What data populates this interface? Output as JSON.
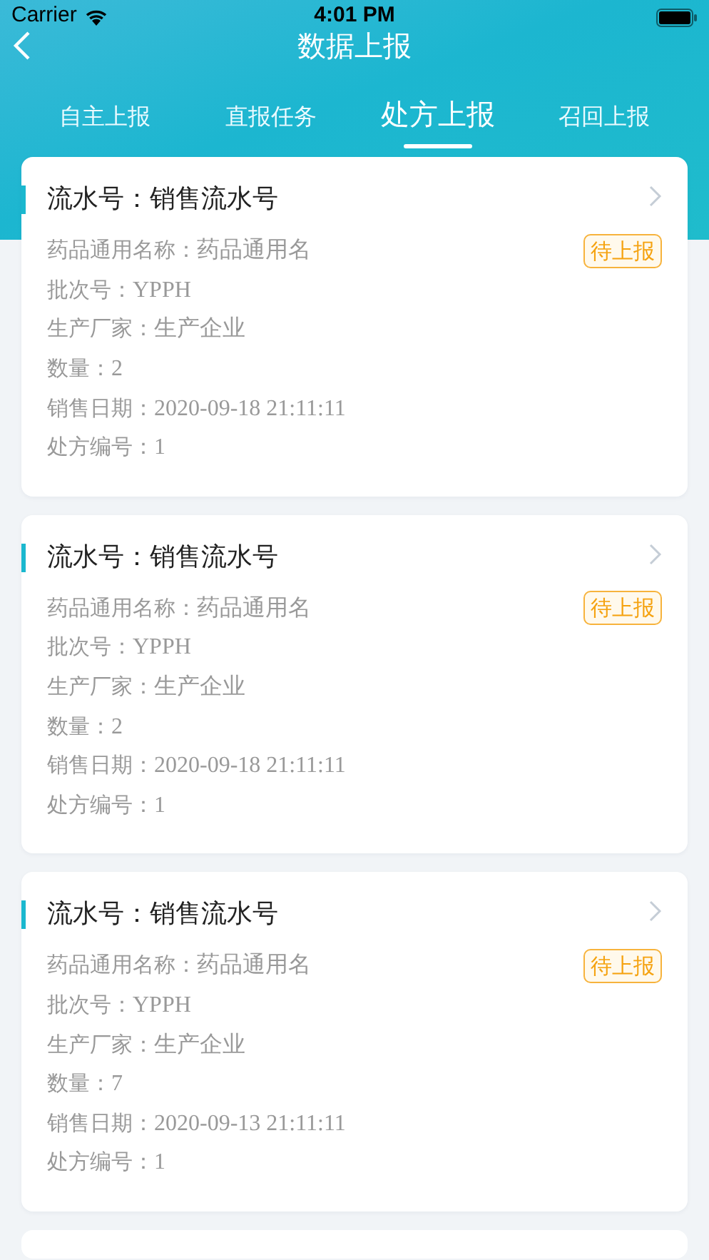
{
  "status_bar": {
    "carrier": "Carrier",
    "time": "4:01 PM"
  },
  "nav": {
    "title": "数据上报"
  },
  "tabs": [
    {
      "label": "自主上报",
      "selected": false
    },
    {
      "label": "直报任务",
      "selected": false
    },
    {
      "label": "处方上报",
      "selected": true
    },
    {
      "label": "召回上报",
      "selected": false
    }
  ],
  "records": [
    {
      "title": "流水号：销售流水号",
      "status": "待上报",
      "fields": [
        {
          "label": "药品通用名称：",
          "value": "药品通用名"
        },
        {
          "label": "批次号：",
          "value": "YPPH"
        },
        {
          "label": "生产厂家：",
          "value": "生产企业"
        },
        {
          "label": "数量：",
          "value": "2"
        },
        {
          "label": "销售日期：",
          "value": "2020-09-18 21:11:11"
        },
        {
          "label": "处方编号：",
          "value": "1"
        }
      ]
    },
    {
      "title": "流水号：销售流水号",
      "status": "待上报",
      "fields": [
        {
          "label": "药品通用名称：",
          "value": "药品通用名"
        },
        {
          "label": "批次号：",
          "value": "YPPH"
        },
        {
          "label": "生产厂家：",
          "value": "生产企业"
        },
        {
          "label": "数量：",
          "value": "2"
        },
        {
          "label": "销售日期：",
          "value": "2020-09-18 21:11:11"
        },
        {
          "label": "处方编号：",
          "value": "1"
        }
      ]
    },
    {
      "title": "流水号：销售流水号",
      "status": "待上报",
      "fields": [
        {
          "label": "药品通用名称：",
          "value": "药品通用名"
        },
        {
          "label": "批次号：",
          "value": "YPPH"
        },
        {
          "label": "生产厂家：",
          "value": "生产企业"
        },
        {
          "label": "数量：",
          "value": "7"
        },
        {
          "label": "销售日期：",
          "value": "2020-09-13 21:11:11"
        },
        {
          "label": "处方编号：",
          "value": "1"
        }
      ]
    }
  ]
}
